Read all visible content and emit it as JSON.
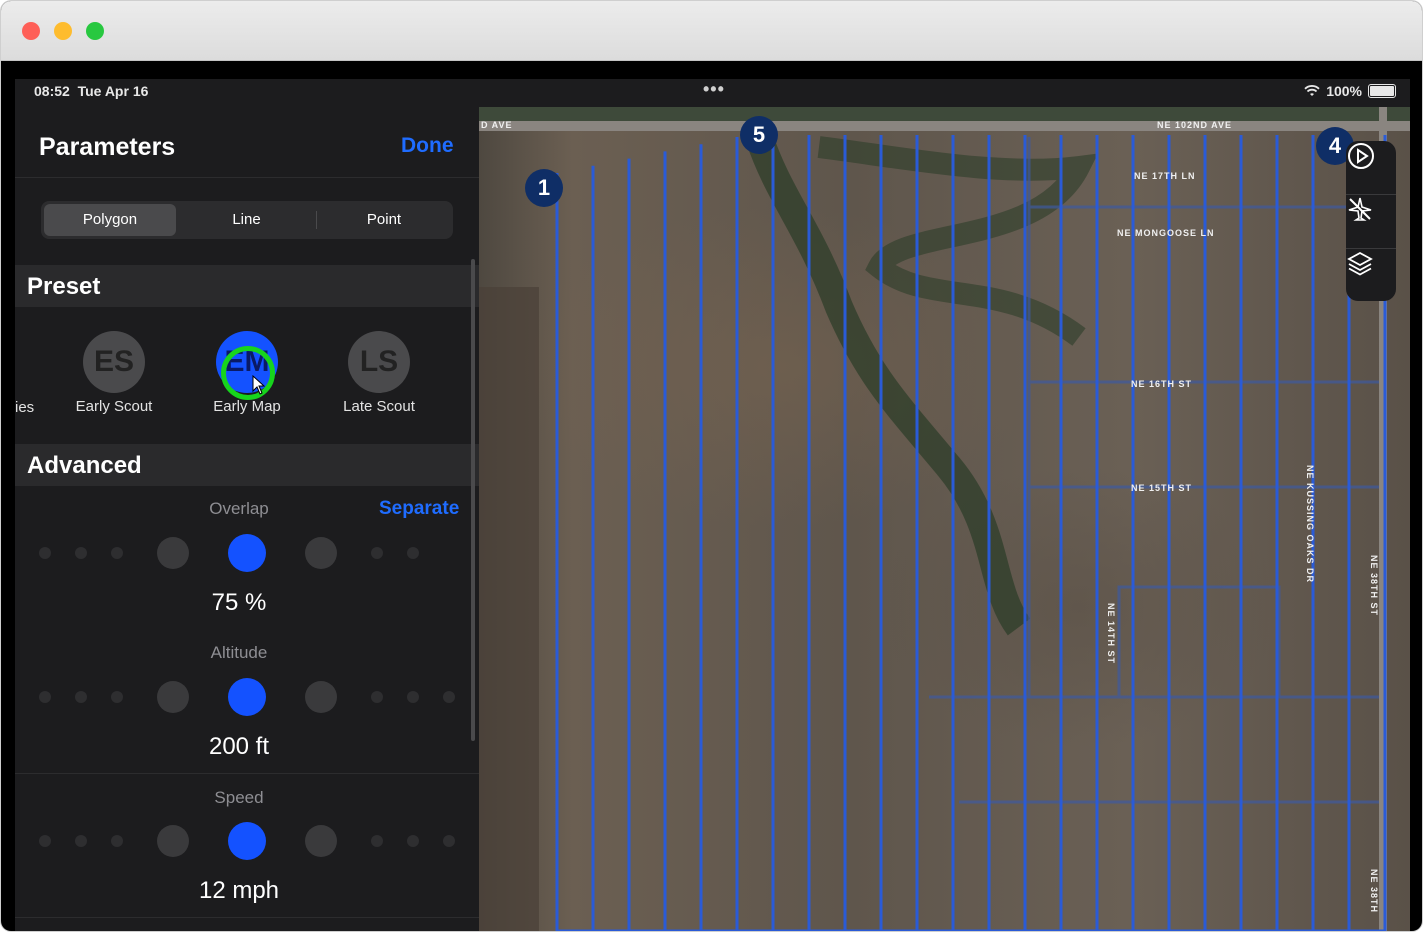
{
  "status": {
    "time": "08:52",
    "date": "Tue Apr 16",
    "battery": "100%"
  },
  "panel": {
    "title": "Parameters",
    "done_label": "Done",
    "geometry_tabs": [
      "Polygon",
      "Line",
      "Point"
    ],
    "active_tab": "Polygon"
  },
  "preset": {
    "header": "Preset",
    "partial_label": "ies",
    "items": [
      {
        "initials": "ES",
        "label": "Early Scout"
      },
      {
        "initials": "EM",
        "label": "Early Map",
        "selected": true
      },
      {
        "initials": "LS",
        "label": "Late Scout"
      }
    ]
  },
  "advanced": {
    "header": "Advanced",
    "separate_label": "Separate",
    "overlap": {
      "label": "Overlap",
      "value": "75 %"
    },
    "altitude": {
      "label": "Altitude",
      "value": "200 ft"
    },
    "speed": {
      "label": "Speed",
      "value": "12 mph"
    }
  },
  "map": {
    "waypoints": [
      "1",
      "5",
      "4"
    ],
    "road_labels": {
      "top_left": "D AVE",
      "top_right": "NE 102ND AVE",
      "r1": "NE 17TH LN",
      "r2": "NE MONGOOSE LN",
      "r3": "NE 16TH ST",
      "r4": "NE 15TH ST",
      "v1": "NE 14TH ST",
      "v2": "NE KUSSING OAKS DR",
      "v3": "NE 38TH ST",
      "v4": "NE 38TH"
    },
    "flight_path_color": "#2a5bd7"
  },
  "colors": {
    "accent": "#1f6cff",
    "click_ring": "#17d41d"
  }
}
